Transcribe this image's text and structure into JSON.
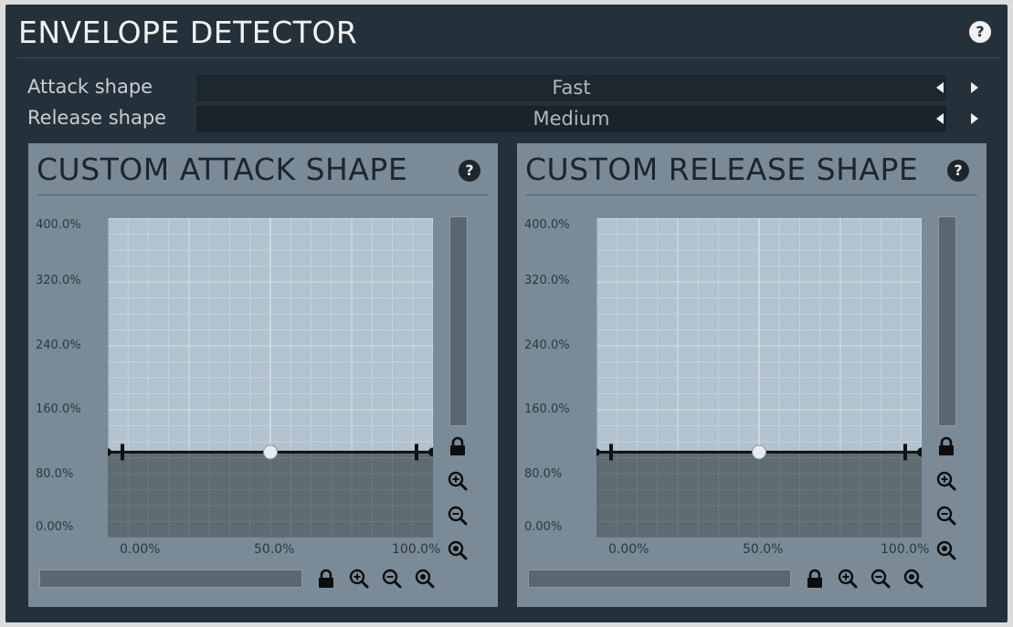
{
  "header": {
    "title": "ENVELOPE DETECTOR",
    "help_label": "?"
  },
  "properties": [
    {
      "label": "Attack shape",
      "value": "Fast"
    },
    {
      "label": "Release shape",
      "value": "Medium"
    }
  ],
  "panels": [
    {
      "title": "CUSTOM ATTACK SHAPE",
      "help_label": "?",
      "y_ticks": [
        "400.0%",
        "320.0%",
        "240.0%",
        "160.0%",
        "80.0%",
        "0.00%"
      ],
      "x_ticks": [
        "0.00%",
        "50.0%",
        "100.0%"
      ],
      "curve_level_pct": 100
    },
    {
      "title": "CUSTOM RELEASE SHAPE",
      "help_label": "?",
      "y_ticks": [
        "400.0%",
        "320.0%",
        "240.0%",
        "160.0%",
        "80.0%",
        "0.00%"
      ],
      "x_ticks": [
        "0.00%",
        "50.0%",
        "100.0%"
      ],
      "curve_level_pct": 100
    }
  ],
  "icons": {
    "lock": "lock-icon",
    "zoom_in": "zoom-in-icon",
    "zoom_out": "zoom-out-icon",
    "zoom_reset": "zoom-reset-icon",
    "arrow_left": "arrow-left-icon",
    "arrow_right": "arrow-right-icon"
  },
  "colors": {
    "window_bg": "#25313a",
    "panel_bg": "#7a8b97",
    "graph_light": "#b8c8d4",
    "graph_dark": "#5f6b73",
    "curve": "#111111"
  }
}
